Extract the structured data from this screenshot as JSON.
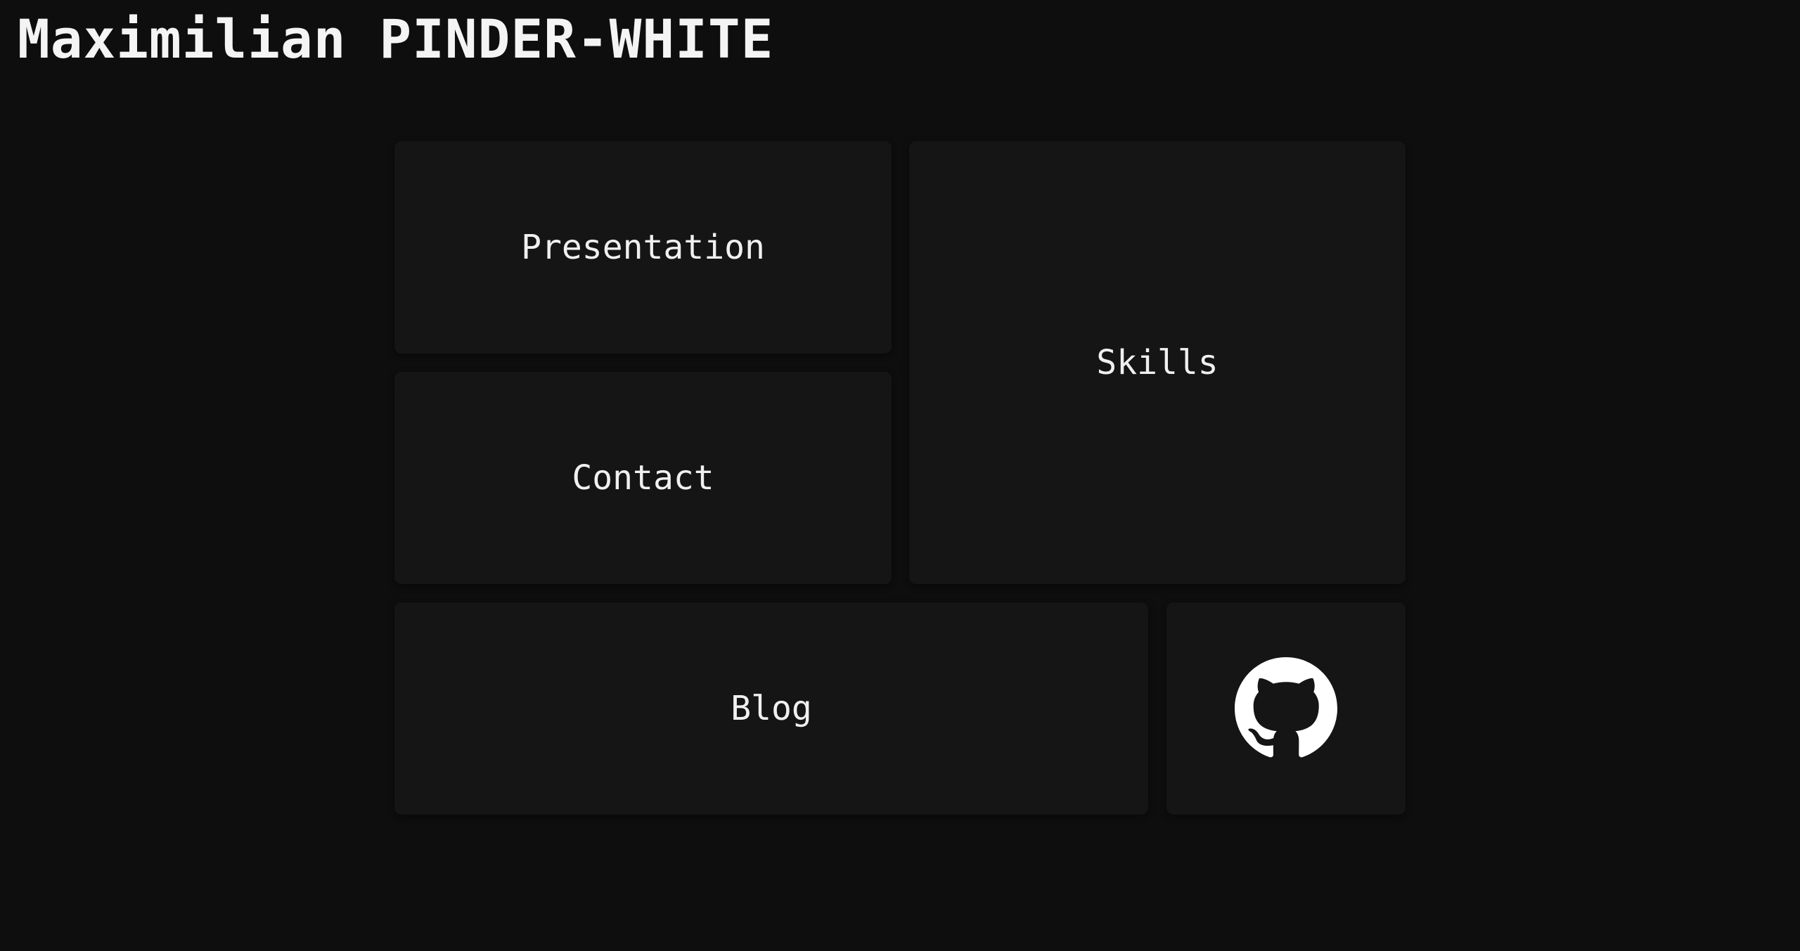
{
  "header": {
    "title": "Maximilian PINDER-WHITE"
  },
  "tiles": {
    "presentation": "Presentation",
    "skills": "Skills",
    "contact": "Contact",
    "blog": "Blog",
    "github_icon": "github-icon"
  },
  "colors": {
    "background": "#0e0e0f",
    "tile": "#151516",
    "text": "#f2f2f2"
  }
}
